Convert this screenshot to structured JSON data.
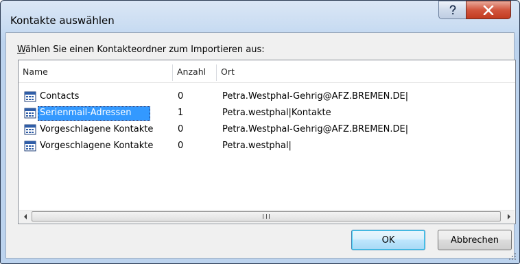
{
  "window": {
    "title": "Kontakte auswählen"
  },
  "prompt": {
    "mnemonic": "W",
    "rest": "ählen Sie einen Kontakteordner zum Importieren aus:"
  },
  "columns": {
    "name": "Name",
    "count": "Anzahl",
    "location": "Ort"
  },
  "rows": [
    {
      "name": "Contacts",
      "count": "0",
      "location": "Petra.Westphal-Gehrig@AFZ.BREMEN.DE|",
      "selected": false
    },
    {
      "name": "Serienmail-Adressen",
      "count": "1",
      "location": "Petra.westphal|Kontakte",
      "selected": true
    },
    {
      "name": "Vorgeschlagene Kontakte",
      "count": "0",
      "location": "Petra.Westphal-Gehrig@AFZ.BREMEN.DE|",
      "selected": false
    },
    {
      "name": "Vorgeschlagene Kontakte",
      "count": "0",
      "location": "Petra.westphal|",
      "selected": false
    }
  ],
  "buttons": {
    "ok": "OK",
    "cancel": "Abbrechen"
  },
  "icons": {
    "help": "help-icon",
    "close": "close-icon",
    "contact_folder": "contact-folder-icon"
  },
  "colors": {
    "selection": "#3399ff",
    "close_button": "#c23b1f"
  }
}
